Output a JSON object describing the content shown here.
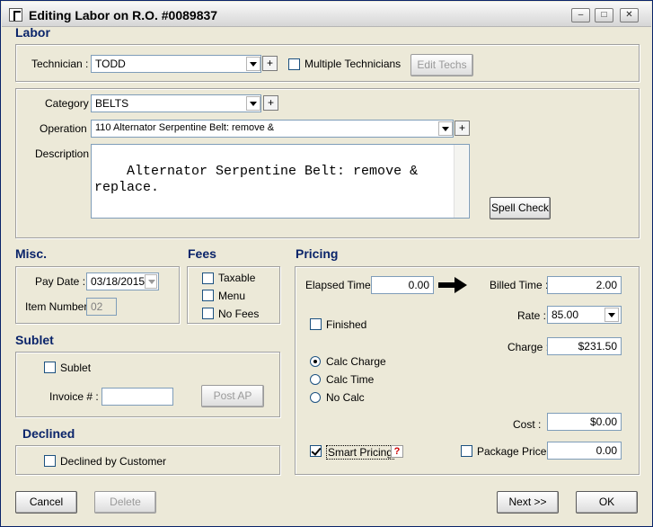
{
  "window": {
    "title": "Editing Labor on R.O. #0089837",
    "minimize": "–",
    "maximize": "□",
    "close": "✕"
  },
  "labor": {
    "section_title": "Labor",
    "technician_label": "Technician :",
    "technician_value": "TODD",
    "plus": "+",
    "multiple_technicians_label": "Multiple Technicians",
    "multiple_technicians_checked": false,
    "edit_techs_label": "Edit Techs",
    "category_label": "Category :",
    "category_value": "BELTS",
    "operation_label": "Operation :",
    "operation_value": "110  Alternator Serpentine Belt: remove &",
    "description_label": "Description :",
    "description_value": "Alternator Serpentine Belt: remove & replace.",
    "spell_check_label": "Spell Check"
  },
  "misc": {
    "section_title": "Misc.",
    "pay_date_label": "Pay Date :",
    "pay_date_value": "03/18/2015",
    "item_number_label": "Item Number :",
    "item_number_value": "02"
  },
  "fees": {
    "section_title": "Fees",
    "items": [
      {
        "label": "Taxable",
        "checked": false
      },
      {
        "label": "Menu",
        "checked": false
      },
      {
        "label": "No Fees",
        "checked": false
      }
    ]
  },
  "sublet": {
    "section_title": "Sublet",
    "sublet_label": "Sublet",
    "sublet_checked": false,
    "invoice_label": "Invoice # :",
    "invoice_value": "",
    "post_ap_label": "Post AP"
  },
  "declined": {
    "section_title": "Declined",
    "declined_label": "Declined by Customer",
    "declined_checked": false
  },
  "pricing": {
    "section_title": "Pricing",
    "elapsed_time_label": "Elapsed Time :",
    "elapsed_time_value": "0.00",
    "billed_time_label": "Billed Time :",
    "billed_time_value": "2.00",
    "finished_label": "Finished",
    "finished_checked": false,
    "rate_label": "Rate :",
    "rate_value": "85.00",
    "charge_label": "Charge :",
    "charge_value": "$231.50",
    "calc_options": [
      {
        "label": "Calc Charge",
        "selected": true
      },
      {
        "label": "Calc Time",
        "selected": false
      },
      {
        "label": "No Calc",
        "selected": false
      }
    ],
    "cost_label": "Cost :",
    "cost_value": "$0.00",
    "smart_pricing_label": "Smart Pricing",
    "smart_pricing_checked": true,
    "help_glyph": "?",
    "package_price_label": "Package Price :",
    "package_price_checked": false,
    "package_price_value": "0.00"
  },
  "footer": {
    "cancel_label": "Cancel",
    "delete_label": "Delete",
    "next_label": "Next >>",
    "ok_label": "OK"
  }
}
